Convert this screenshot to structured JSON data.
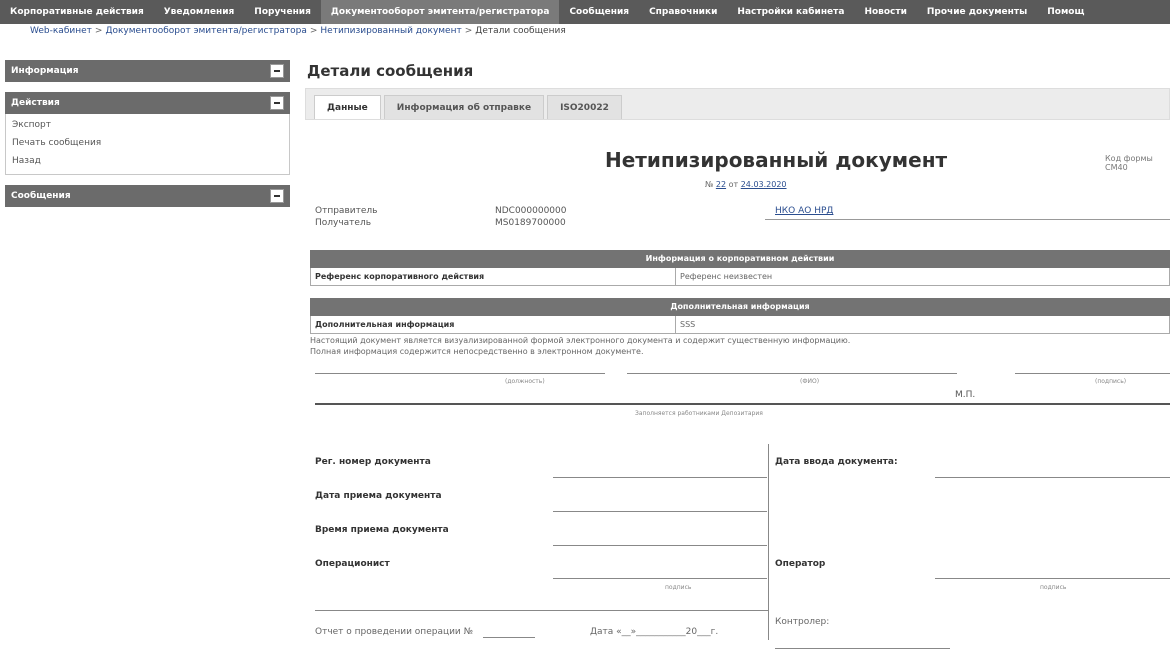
{
  "topnav": {
    "items": [
      "Корпоративные действия",
      "Уведомления",
      "Поручения",
      "Документооборот эмитента/регистратора",
      "Сообщения",
      "Справочники",
      "Настройки кабинета",
      "Новости",
      "Прочие документы",
      "Помощ"
    ],
    "active_index": 3
  },
  "breadcrumb": {
    "items": [
      "Web-кабинет",
      "Документооборот эмитента/регистратора",
      "Нетипизированный документ",
      "Детали сообщения"
    ],
    "separator": ">"
  },
  "sidebar": {
    "panels": [
      {
        "title": "Информация",
        "items": []
      },
      {
        "title": "Действия",
        "items": [
          "Экспорт",
          "Печать сообщения",
          "Назад"
        ]
      },
      {
        "title": "Сообщения",
        "items": []
      }
    ]
  },
  "main": {
    "title": "Детали сообщения",
    "tabs": [
      "Данные",
      "Информация об отправке",
      "ISO20022"
    ],
    "active_tab": 0
  },
  "document": {
    "title": "Нетипизированный документ",
    "form_code": "Код формы CM40",
    "number_prefix": "№",
    "number": "22",
    "date_prefix": "от",
    "date": "24.03.2020",
    "sender_label": "Отправитель",
    "sender_code": "NDC000000000",
    "receiver_label": "Получатель",
    "receiver_code": "MS0189700000",
    "org": "НКО АО НРД"
  },
  "corp_action_section": {
    "header": "Информация о корпоративном действии",
    "key": "Референс корпоративного действия",
    "value": "Референс неизвестен"
  },
  "extra_section": {
    "header": "Дополнительная информация",
    "key": "Дополнительная информация",
    "value": "SSS"
  },
  "notice": {
    "line1": "Настоящий документ является визуализированной формой электронного документа и содержит существенную информацию.",
    "line2": "Полная информация содержится непосредственно в электронном документе."
  },
  "signature": {
    "position": "(должность)",
    "name": "(ФИО)",
    "sign": "(подпись)",
    "mp": "М.П.",
    "depository_note": "Заполняется работниками Депозитария"
  },
  "registration": {
    "reg_number": "Рег. номер документа",
    "receive_date": "Дата приема документа",
    "receive_time": "Время приема документа",
    "operationist": "Операционист",
    "input_date": "Дата ввода документа:",
    "operator": "Оператор",
    "sign_small": "подпись",
    "report": "Отчет о проведении операции №",
    "report_date": "Дата «__»___________20___г.",
    "controller": "Контролер:"
  },
  "colors": {
    "nav_bg": "#5a5a5a",
    "nav_active": "#7a7a7a",
    "section_header": "#737373",
    "link": "#2a4d8f"
  }
}
